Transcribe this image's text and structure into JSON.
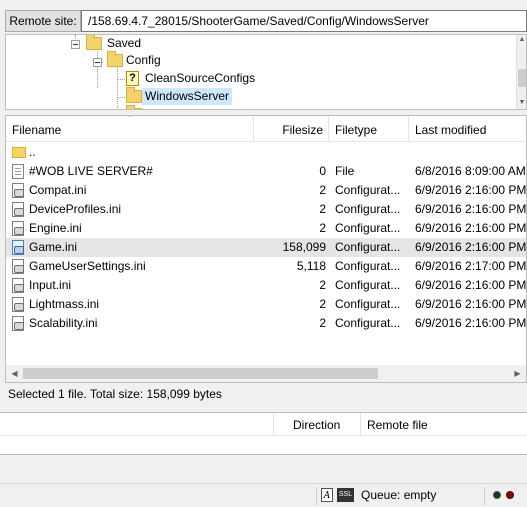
{
  "remote_site": {
    "label": "Remote site:",
    "path": "/158.69.4.7_28015/ShooterGame/Saved/Config/WindowsServer"
  },
  "tree": {
    "items": [
      {
        "label": "Saved",
        "icon": "folder-icon"
      },
      {
        "label": "Config",
        "icon": "folder-icon"
      },
      {
        "label": "CleanSourceConfigs",
        "icon": "unknown-folder-icon"
      },
      {
        "label": "WindowsServer",
        "icon": "folder-icon",
        "selected": true
      }
    ]
  },
  "file_list": {
    "columns": {
      "filename": "Filename",
      "filesize": "Filesize",
      "filetype": "Filetype",
      "last_modified": "Last modified"
    },
    "rows": [
      {
        "name": "..",
        "size": "",
        "type": "",
        "modified": "",
        "icon": "parent-folder-icon"
      },
      {
        "name": "#WOB LIVE SERVER#",
        "size": "0",
        "type": "File",
        "modified": "6/8/2016 8:09:00 AM",
        "icon": "file-icon"
      },
      {
        "name": "Compat.ini",
        "size": "2",
        "type": "Configurat...",
        "modified": "6/9/2016 2:16:00 PM",
        "icon": "ini-file-icon"
      },
      {
        "name": "DeviceProfiles.ini",
        "size": "2",
        "type": "Configurat...",
        "modified": "6/9/2016 2:16:00 PM",
        "icon": "ini-file-icon"
      },
      {
        "name": "Engine.ini",
        "size": "2",
        "type": "Configurat...",
        "modified": "6/9/2016 2:16:00 PM",
        "icon": "ini-file-icon"
      },
      {
        "name": "Game.ini",
        "size": "158,099",
        "type": "Configurat...",
        "modified": "6/9/2016 2:16:00 PM",
        "icon": "ini-file-icon",
        "selected": true
      },
      {
        "name": "GameUserSettings.ini",
        "size": "5,118",
        "type": "Configurat...",
        "modified": "6/9/2016 2:17:00 PM",
        "icon": "ini-file-icon"
      },
      {
        "name": "Input.ini",
        "size": "2",
        "type": "Configurat...",
        "modified": "6/9/2016 2:16:00 PM",
        "icon": "ini-file-icon"
      },
      {
        "name": "Lightmass.ini",
        "size": "2",
        "type": "Configurat...",
        "modified": "6/9/2016 2:16:00 PM",
        "icon": "ini-file-icon"
      },
      {
        "name": "Scalability.ini",
        "size": "2",
        "type": "Configurat...",
        "modified": "6/9/2016 2:16:00 PM",
        "icon": "ini-file-icon"
      }
    ]
  },
  "selection_status": "Selected 1 file. Total size: 158,099 bytes",
  "queue": {
    "columns": {
      "direction": "Direction",
      "remote_file": "Remote file"
    }
  },
  "status_bar": {
    "queue_text": "Queue: empty",
    "indicators": [
      {
        "name": "receive-led",
        "color": "#3a3a3a"
      },
      {
        "name": "send-led",
        "color": "#c00000"
      }
    ],
    "colors": {
      "selection": "#cce8ff",
      "row_selected": "#e5e5e5"
    }
  }
}
